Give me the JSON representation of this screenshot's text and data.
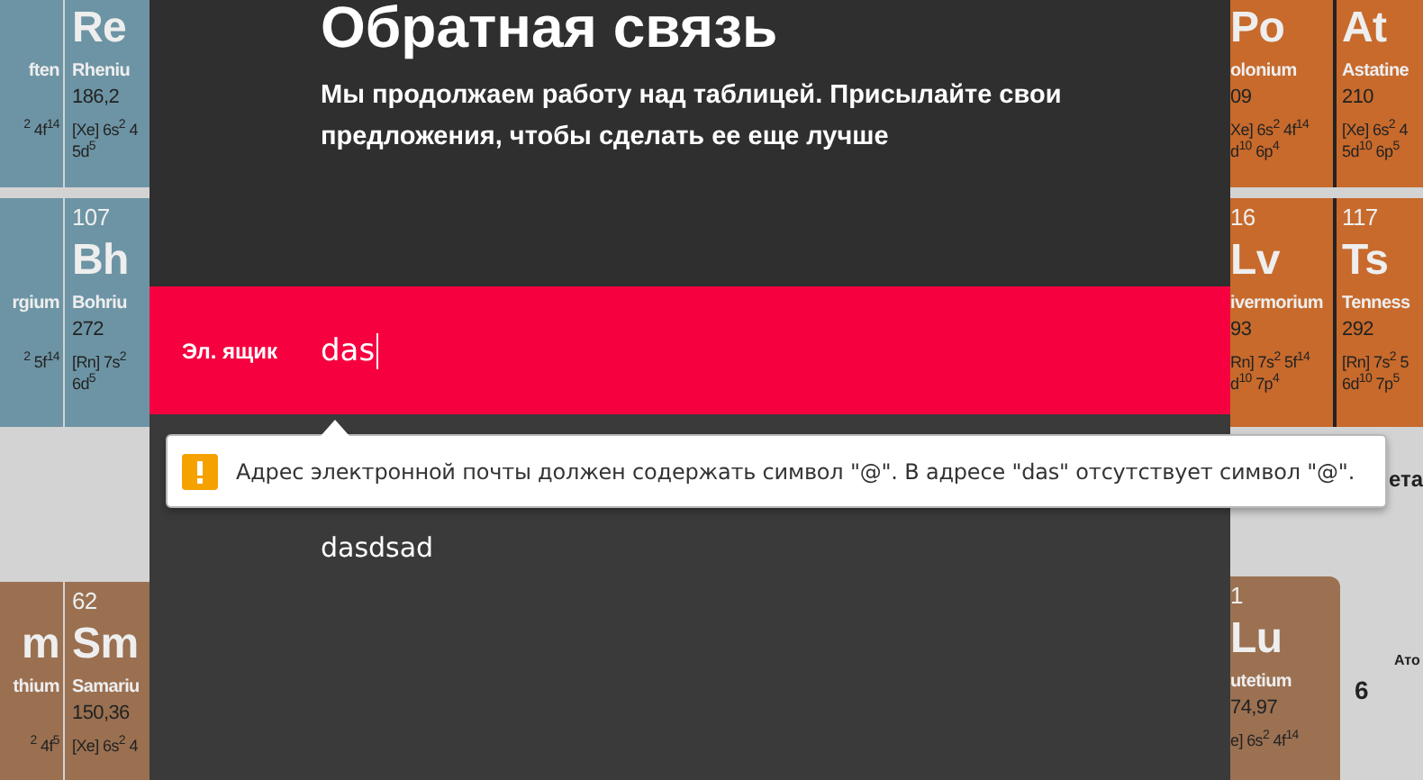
{
  "background_table": {
    "left_rows": [
      [
        {
          "color": "#6d94a4",
          "name": "ften",
          "config": [
            "$^{2}$ 4f$^{14}$"
          ]
        },
        {
          "color": "#6d94a4",
          "symbol": "Re",
          "name": "Rheniu",
          "mass": "186,2",
          "config": [
            "[Xe] 6s$^{2}$ 4",
            "5d$^{5}$"
          ]
        }
      ],
      [
        {
          "color": "#6d94a4",
          "name": "rgium",
          "config": [
            "$^{2}$ 5f$^{14}$"
          ]
        },
        {
          "color": "#6d94a4",
          "number": "107",
          "symbol": "Bh",
          "name": "Bohriu",
          "mass": "272",
          "config": [
            "[Rn] 7s$^{2}$",
            "6d$^{5}$"
          ]
        }
      ]
    ],
    "left_bottom": [
      {
        "color": "#9a7051",
        "symbol": "m",
        "name": "thium",
        "config": [
          "$^{2}$ 4f$^{5}$"
        ]
      },
      {
        "color": "#9a7051",
        "number": "62",
        "symbol": "Sm",
        "name": "Samariu",
        "mass": "150,36",
        "config": [
          "[Xe] 6s$^{2}$ 4"
        ]
      }
    ],
    "right_rows": [
      [
        {
          "color": "#c76a2c",
          "symbol": "Po",
          "name": "olonium",
          "mass": "09",
          "config": [
            "Xe] 6s$^{2}$ 4f$^{14}$",
            "d$^{10}$ 6p$^{4}$"
          ]
        },
        {
          "color": "#c76a2c",
          "symbol": "At",
          "name": "Astatine",
          "mass": "210",
          "config": [
            "[Xe] 6s$^{2}$ 4",
            "5d$^{10}$ 6p$^{5}$"
          ]
        }
      ],
      [
        {
          "color": "#c76a2c",
          "number": "16",
          "symbol": "Lv",
          "name": "ivermorium",
          "mass": "93",
          "config": [
            "Rn] 7s$^{2}$ 5f$^{14}$",
            "d$^{10}$ 7p$^{4}$"
          ]
        },
        {
          "color": "#c76a2c",
          "number": "117",
          "symbol": "Ts",
          "name": "Tenness",
          "mass": "292",
          "config": [
            "[Rn] 7s$^{2}$ 5",
            "6d$^{10}$ 7p$^{5}$"
          ]
        }
      ]
    ],
    "right_legend_top": "ета",
    "right_bottom": [
      {
        "color": "#9b7152",
        "number": "1",
        "symbol": "Lu",
        "name": "utetium",
        "mass": "74,97",
        "config": [
          "e] 6s$^{2}$ 4f$^{14}$"
        ]
      }
    ],
    "right_legend": [
      "Ато",
      "6"
    ]
  },
  "dialog": {
    "title": "Обратная связь",
    "description": "Мы продолжаем работу над таблицей. Присылайте свои предложения, чтобы сделать ее еще лучше",
    "fields": [
      {
        "kind": "input",
        "label": "Эл. ящик",
        "value": "das",
        "focused": true
      },
      {
        "kind": "textarea",
        "value": "dasdsad",
        "focused": false
      }
    ]
  },
  "validation_tooltip": {
    "message": "Адрес электронной почты должен содержать символ \"@\". В адресе \"das\" отсутствует символ \"@\"."
  }
}
